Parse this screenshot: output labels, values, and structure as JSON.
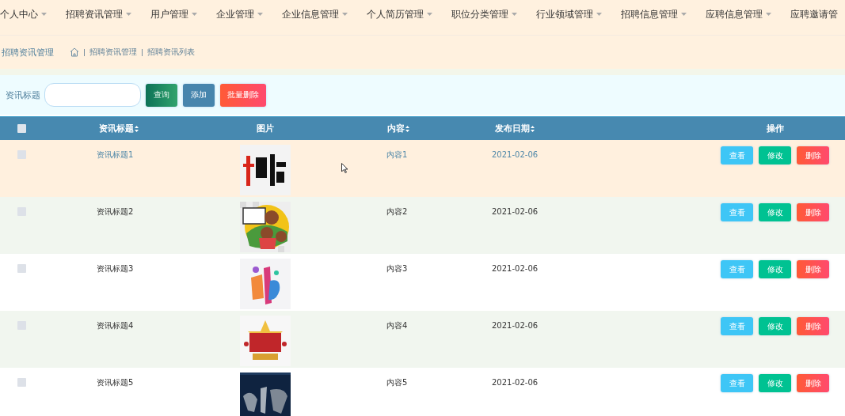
{
  "nav": [
    {
      "label": "个人中心",
      "dropdown": true
    },
    {
      "label": "招聘资讯管理",
      "dropdown": true
    },
    {
      "label": "用户管理",
      "dropdown": true
    },
    {
      "label": "企业管理",
      "dropdown": true
    },
    {
      "label": "企业信息管理",
      "dropdown": true
    },
    {
      "label": "个人简历管理",
      "dropdown": true
    },
    {
      "label": "职位分类管理",
      "dropdown": true
    },
    {
      "label": "行业领域管理",
      "dropdown": true
    },
    {
      "label": "招聘信息管理",
      "dropdown": true
    },
    {
      "label": "应聘信息管理",
      "dropdown": true
    },
    {
      "label": "应聘邀请管",
      "dropdown": false
    }
  ],
  "page_title": "招聘资讯管理",
  "breadcrumb": [
    "招聘资讯管理",
    "招聘资讯列表"
  ],
  "search": {
    "label": "资讯标题"
  },
  "buttons": [
    {
      "label": "查询",
      "kind": "search"
    },
    {
      "label": "添加",
      "kind": "add"
    },
    {
      "label": "批量删除",
      "kind": "delete"
    }
  ],
  "table": {
    "select_all": {
      "checked": false
    },
    "columns": [
      {
        "label": "资讯标题",
        "sortable": true
      },
      {
        "label": "图片",
        "sortable": false
      },
      {
        "label": "内容",
        "sortable": true
      },
      {
        "label": "发布日期",
        "sortable": true
      },
      {
        "label": "操作",
        "sortable": false
      }
    ],
    "rows": [
      {
        "checked": false,
        "hovered": true,
        "title": "资讯标题1",
        "content": "内容1",
        "date": "2021-02-06",
        "actions": [
          {
            "label": "查看",
            "kind": "view"
          },
          {
            "label": "修改",
            "kind": "edit"
          },
          {
            "label": "删除",
            "kind": "delete"
          }
        ]
      },
      {
        "checked": false,
        "hovered": false,
        "title": "资讯标题2",
        "content": "内容2",
        "date": "2021-02-06",
        "actions": [
          {
            "label": "查看",
            "kind": "view"
          },
          {
            "label": "修改",
            "kind": "edit"
          },
          {
            "label": "删除",
            "kind": "delete"
          }
        ]
      },
      {
        "checked": false,
        "hovered": false,
        "title": "资讯标题3",
        "content": "内容3",
        "date": "2021-02-06",
        "actions": [
          {
            "label": "查看",
            "kind": "view"
          },
          {
            "label": "修改",
            "kind": "edit"
          },
          {
            "label": "删除",
            "kind": "delete"
          }
        ]
      },
      {
        "checked": false,
        "hovered": false,
        "title": "资讯标题4",
        "content": "内容4",
        "date": "2021-02-06",
        "actions": [
          {
            "label": "查看",
            "kind": "view"
          },
          {
            "label": "修改",
            "kind": "edit"
          },
          {
            "label": "删除",
            "kind": "delete"
          }
        ]
      },
      {
        "checked": false,
        "hovered": false,
        "title": "资讯标题5",
        "content": "内容5",
        "date": "2021-02-06",
        "actions": [
          {
            "label": "查看",
            "kind": "view"
          },
          {
            "label": "修改",
            "kind": "edit"
          },
          {
            "label": "删除",
            "kind": "delete"
          }
        ]
      }
    ]
  }
}
